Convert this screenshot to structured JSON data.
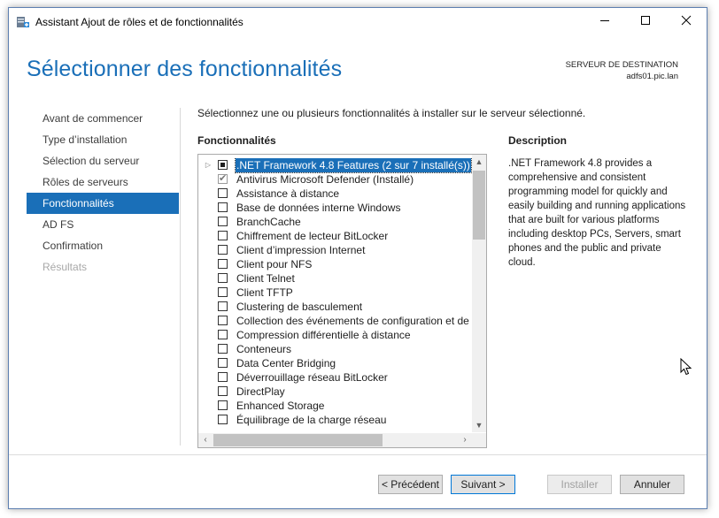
{
  "window": {
    "title": "Assistant Ajout de rôles et de fonctionnalités",
    "minimize_icon": "minimize-icon",
    "maximize_icon": "maximize-icon",
    "close_icon": "close-icon"
  },
  "header": {
    "title": "Sélectionner des fonctionnalités",
    "destination_label": "SERVEUR DE DESTINATION",
    "destination_server": "adfs01.pic.lan"
  },
  "nav": {
    "items": [
      {
        "label": "Avant de commencer",
        "state": "normal"
      },
      {
        "label": "Type d’installation",
        "state": "normal"
      },
      {
        "label": "Sélection du serveur",
        "state": "normal"
      },
      {
        "label": "Rôles de serveurs",
        "state": "normal"
      },
      {
        "label": "Fonctionnalités",
        "state": "active"
      },
      {
        "label": "AD FS",
        "state": "normal"
      },
      {
        "label": "Confirmation",
        "state": "normal"
      },
      {
        "label": "Résultats",
        "state": "disabled"
      }
    ]
  },
  "main": {
    "intro": "Sélectionnez une ou plusieurs fonctionnalités à installer sur le serveur sélectionné.",
    "features_heading": "Fonctionnalités",
    "description_heading": "Description",
    "description_text": ".NET Framework 4.8 provides a comprehensive and consistent programming model for quickly and easily building and running applications that are built for various platforms including desktop PCs, Servers, smart phones and the public and private cloud.",
    "features": [
      {
        "label": ".NET Framework 4.8 Features (2 sur 7 installé(s))",
        "state": "partial",
        "expandable": true,
        "selected": true
      },
      {
        "label": "Antivirus Microsoft Defender (Installé)",
        "state": "installed"
      },
      {
        "label": "Assistance à distance",
        "state": "unchecked"
      },
      {
        "label": "Base de données interne Windows",
        "state": "unchecked"
      },
      {
        "label": "BranchCache",
        "state": "unchecked"
      },
      {
        "label": "Chiffrement de lecteur BitLocker",
        "state": "unchecked"
      },
      {
        "label": "Client d’impression Internet",
        "state": "unchecked"
      },
      {
        "label": "Client pour NFS",
        "state": "unchecked"
      },
      {
        "label": "Client Telnet",
        "state": "unchecked"
      },
      {
        "label": "Client TFTP",
        "state": "unchecked"
      },
      {
        "label": "Clustering de basculement",
        "state": "unchecked"
      },
      {
        "label": "Collection des événements de configuration et de",
        "state": "unchecked"
      },
      {
        "label": "Compression différentielle à distance",
        "state": "unchecked"
      },
      {
        "label": "Conteneurs",
        "state": "unchecked"
      },
      {
        "label": "Data Center Bridging",
        "state": "unchecked"
      },
      {
        "label": "Déverrouillage réseau BitLocker",
        "state": "unchecked"
      },
      {
        "label": "DirectPlay",
        "state": "unchecked"
      },
      {
        "label": "Enhanced Storage",
        "state": "unchecked"
      },
      {
        "label": "Équilibrage de la charge réseau",
        "state": "unchecked"
      }
    ]
  },
  "buttons": {
    "previous": "< Précédent",
    "next": "Suivant >",
    "install": "Installer",
    "cancel": "Annuler"
  },
  "colors": {
    "accent": "#1a6fb8",
    "window_border": "#5d7fb0"
  }
}
